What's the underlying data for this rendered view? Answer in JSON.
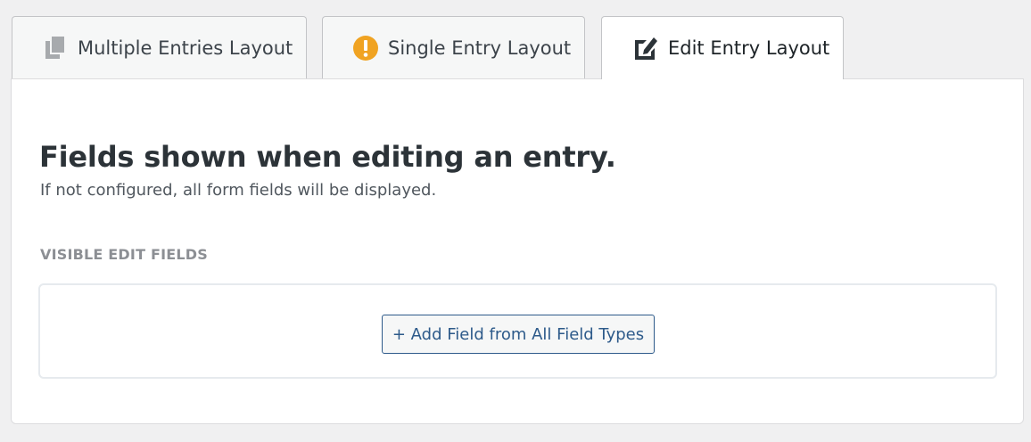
{
  "tabs": [
    {
      "label": "Multiple Entries Layout",
      "icon": "copy-icon",
      "active": false
    },
    {
      "label": "Single Entry Layout",
      "icon": "warning-icon",
      "active": false
    },
    {
      "label": "Edit Entry Layout",
      "icon": "edit-icon",
      "active": true
    }
  ],
  "panel": {
    "heading": "Fields shown when editing an entry.",
    "subtext": "If not configured, all form fields will be displayed.",
    "section_label": "VISIBLE EDIT FIELDS",
    "add_button_label": "+ Add Field from All Field Types"
  },
  "colors": {
    "warning": "#f0a322",
    "link": "#2d5a8a"
  }
}
